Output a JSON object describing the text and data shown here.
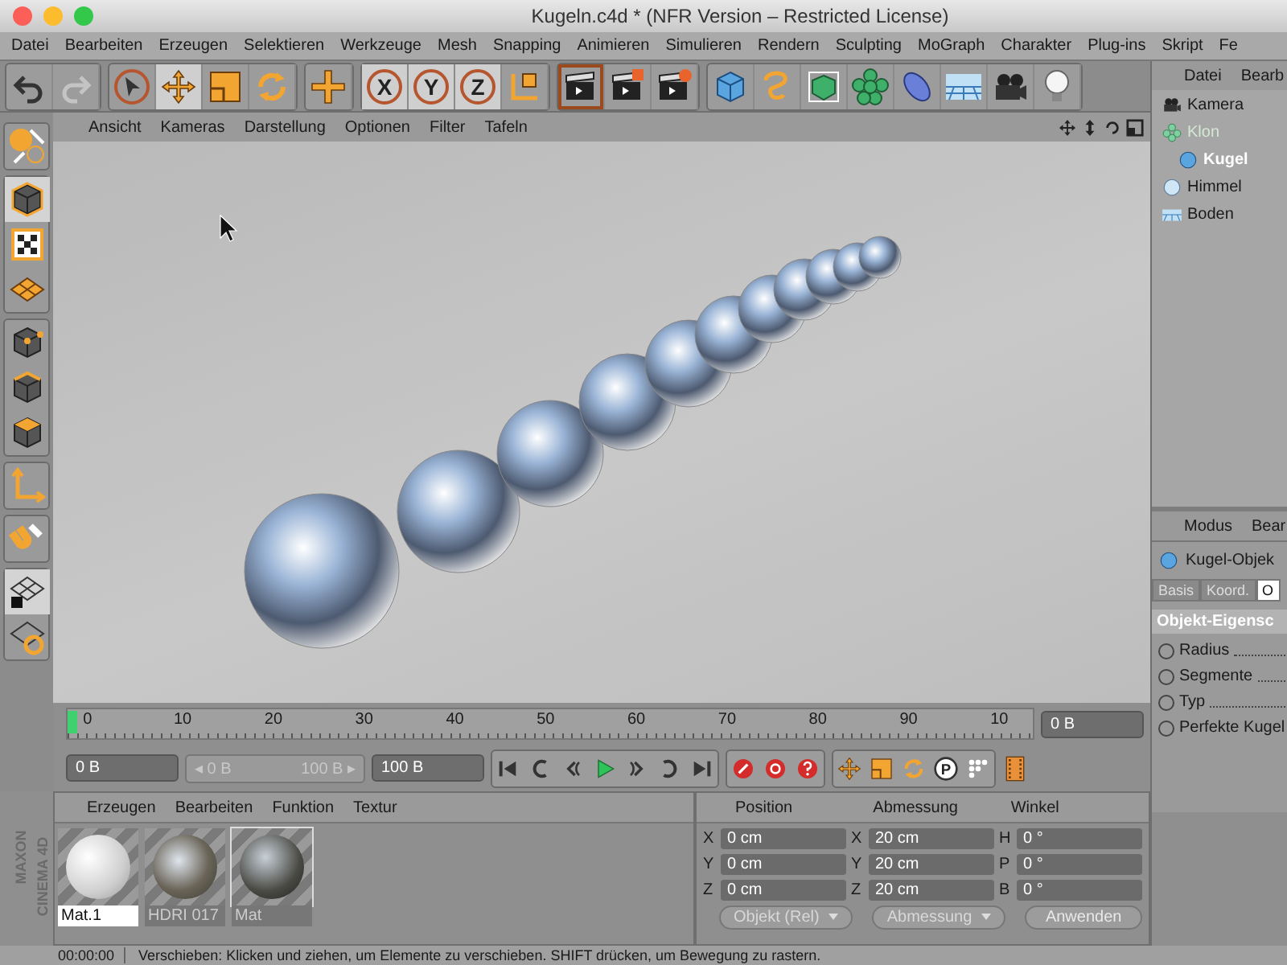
{
  "window": {
    "title": "Kugeln.c4d * (NFR Version – Restricted License)"
  },
  "menu": [
    "Datei",
    "Bearbeiten",
    "Erzeugen",
    "Selektieren",
    "Werkzeuge",
    "Mesh",
    "Snapping",
    "Animieren",
    "Simulieren",
    "Rendern",
    "Sculpting",
    "MoGraph",
    "Charakter",
    "Plug-ins",
    "Skript",
    "Fe"
  ],
  "toolbar": [
    [
      {
        "kind": "undo",
        "selected": false
      },
      {
        "kind": "redo",
        "selected": false
      }
    ],
    [
      {
        "kind": "select",
        "selected": false
      },
      {
        "kind": "move",
        "selected": true
      },
      {
        "kind": "scale",
        "selected": false
      },
      {
        "kind": "rotate",
        "selected": false
      }
    ],
    [
      {
        "kind": "place",
        "selected": false
      }
    ],
    [
      {
        "kind": "axis",
        "label": "X",
        "selected": true
      },
      {
        "kind": "axis",
        "label": "Y",
        "selected": true
      },
      {
        "kind": "axis",
        "label": "Z",
        "selected": true
      },
      {
        "kind": "coords",
        "selected": false
      }
    ],
    [
      {
        "kind": "render-view",
        "selected": true
      },
      {
        "kind": "render-picture",
        "selected": false
      },
      {
        "kind": "render-settings",
        "selected": false
      }
    ],
    [
      {
        "kind": "cube",
        "selected": false
      },
      {
        "kind": "spline",
        "selected": false
      },
      {
        "kind": "nurbs",
        "selected": false
      },
      {
        "kind": "mograph",
        "selected": false
      },
      {
        "kind": "deformer",
        "selected": false
      },
      {
        "kind": "floor",
        "selected": false
      },
      {
        "kind": "camera",
        "selected": false
      },
      {
        "kind": "light",
        "selected": false
      }
    ]
  ],
  "side_tools": [
    [
      {
        "kind": "hdri",
        "selected": false
      }
    ],
    [
      {
        "kind": "model",
        "selected": true
      },
      {
        "kind": "texture",
        "selected": false
      },
      {
        "kind": "workplane",
        "selected": false
      }
    ],
    [
      {
        "kind": "points",
        "selected": false
      },
      {
        "kind": "edges",
        "selected": false
      },
      {
        "kind": "polygons",
        "selected": false
      }
    ],
    [
      {
        "kind": "axes",
        "selected": false
      }
    ],
    [
      {
        "kind": "snap",
        "selected": false
      }
    ],
    [
      {
        "kind": "lock-grid",
        "selected": true
      },
      {
        "kind": "rotate-grid",
        "selected": false
      }
    ]
  ],
  "viewport": {
    "menu": [
      "Ansicht",
      "Kameras",
      "Darstellung",
      "Optionen",
      "Filter",
      "Tafeln"
    ]
  },
  "object_manager": {
    "menu": [
      "Datei",
      "Bearb"
    ],
    "objects": [
      {
        "name": "Kamera",
        "kind": "camera",
        "disabled": false,
        "selected": false
      },
      {
        "name": "Klon",
        "kind": "cloner",
        "disabled": true,
        "selected": false,
        "children": [
          {
            "name": "Kugel",
            "kind": "sphere",
            "disabled": false,
            "selected": true
          }
        ]
      },
      {
        "name": "Himmel",
        "kind": "sky",
        "disabled": false,
        "selected": false
      },
      {
        "name": "Boden",
        "kind": "floor",
        "disabled": false,
        "selected": false
      }
    ]
  },
  "attributes": {
    "menu": [
      "Modus",
      "Bear"
    ],
    "object": "Kugel-Objek",
    "tabs": [
      {
        "label": "Basis",
        "selected": false
      },
      {
        "label": "Koord.",
        "selected": false
      },
      {
        "label": "O",
        "selected": true
      }
    ],
    "section": "Objekt-Eigensc",
    "params": [
      "Radius",
      "Segmente",
      "Typ",
      "Perfekte Kugel"
    ]
  },
  "timeline": {
    "labels": [
      "0",
      "10",
      "20",
      "30",
      "40",
      "50",
      "60",
      "70",
      "80",
      "90",
      "10"
    ],
    "level": 0,
    "frame": "0 B"
  },
  "controls": {
    "start": "0 B",
    "range_start": "◂ 0 B",
    "range_end": "100 B ▸",
    "end": "100 B",
    "playback": [
      {
        "kind": "first"
      },
      {
        "kind": "loop-back"
      },
      {
        "kind": "prev-key"
      },
      {
        "kind": "play"
      },
      {
        "kind": "next-key"
      },
      {
        "kind": "loop-forward"
      },
      {
        "kind": "last"
      }
    ],
    "keys": [
      {
        "kind": "record"
      },
      {
        "kind": "auto-key"
      },
      {
        "kind": "help"
      }
    ],
    "tracks": [
      {
        "kind": "move"
      },
      {
        "kind": "scale"
      },
      {
        "kind": "rotate"
      },
      {
        "kind": "param",
        "label": "P"
      },
      {
        "kind": "dots"
      }
    ]
  },
  "materials": {
    "menu": [
      "Erzeugen",
      "Bearbeiten",
      "Funktion",
      "Textur"
    ],
    "items": [
      {
        "name": "Mat.1",
        "kind": "matte",
        "selected": true
      },
      {
        "name": "HDRI 017",
        "kind": "hdri",
        "selected": false
      },
      {
        "name": "Mat",
        "kind": "chrome",
        "selected": false
      }
    ]
  },
  "logo": {
    "brand": "MAXON",
    "product": "CINEMA 4D"
  },
  "coordinates": {
    "headers": [
      "Position",
      "Abmessung",
      "Winkel"
    ],
    "rows": [
      {
        "axis": "X",
        "position": "0 cm",
        "size_axis": "X",
        "size": "20 cm",
        "angle_axis": "H",
        "angle": "0 °"
      },
      {
        "axis": "Y",
        "position": "0 cm",
        "size_axis": "Y",
        "size": "20 cm",
        "angle_axis": "P",
        "angle": "0 °"
      },
      {
        "axis": "Z",
        "position": "0 cm",
        "size_axis": "Z",
        "size": "20 cm",
        "angle_axis": "B",
        "angle": "0 °"
      }
    ],
    "mode": "Objekt (Rel)",
    "size_mode": "Abmessung",
    "apply": "Anwenden"
  },
  "status_bar": {
    "time": "00:00:00",
    "message": "Verschieben: Klicken und ziehen, um Elemente zu verschieben. SHIFT drücken, um Bewegung zu rastern."
  }
}
